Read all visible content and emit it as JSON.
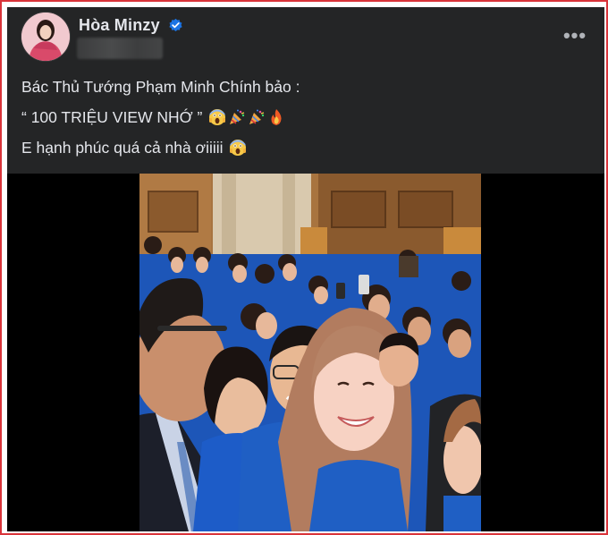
{
  "post": {
    "author": "Hòa Minzy",
    "verified": true,
    "avatar_icon": "profile-avatar",
    "more_icon": "more-horizontal-icon",
    "more_label": "•••",
    "lines": [
      {
        "text": "Bác Thủ Tướng Phạm Minh Chính bảo :",
        "emojis": []
      },
      {
        "text": "“ 100 TRIỆU VIEW NHỚ ” ",
        "emojis": [
          "face-screaming-icon",
          "party-popper-icon",
          "party-popper-icon",
          "fire-icon"
        ]
      },
      {
        "text": "E hạnh phúc quá cả nhà ơiiiii ",
        "emojis": [
          "face-screaming-icon"
        ]
      }
    ],
    "photo_description_icon": "post-photo"
  },
  "colors": {
    "card_bg": "#242526",
    "text": "#e4e6eb",
    "secondary": "#b0b3b8",
    "verified_blue": "#1b74e4",
    "frame_border": "#d9343a",
    "media_bg": "#000000",
    "uniform_blue": "#1f5fc4"
  }
}
